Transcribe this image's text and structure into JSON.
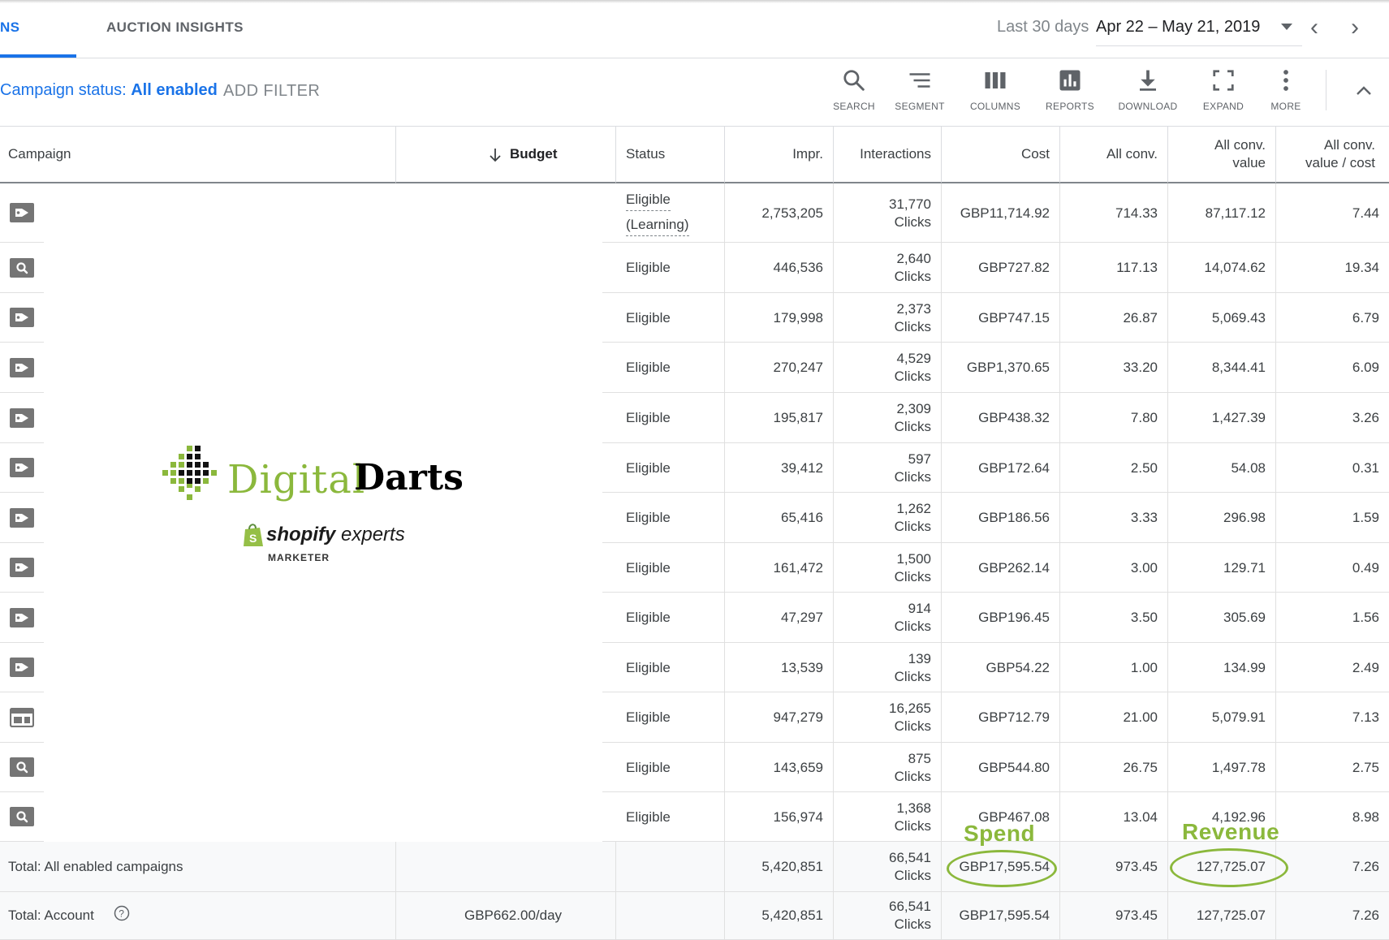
{
  "header": {
    "tab_active": "NS",
    "tab_auction": "AUCTION INSIGHTS",
    "date_label": "Last 30 days",
    "date_range": "Apr 22 – May 21, 2019"
  },
  "filter": {
    "status_label": "Campaign status: ",
    "status_value": "All enabled",
    "add_filter": "ADD FILTER"
  },
  "toolbar": {
    "search": "SEARCH",
    "segment": "SEGMENT",
    "columns": "COLUMNS",
    "reports": "REPORTS",
    "download": "DOWNLOAD",
    "expand": "EXPAND",
    "more": "MORE"
  },
  "columns": {
    "campaign": "Campaign",
    "budget": "Budget",
    "status": "Status",
    "impr": "Impr.",
    "interactions": "Interactions",
    "cost": "Cost",
    "all_conv": "All conv.",
    "all_conv_value_1": "All conv.",
    "all_conv_value_2": "value",
    "value_cost_1": "All conv.",
    "value_cost_2": "value / cost"
  },
  "rows": [
    {
      "icon": "shopping-tag-icon",
      "status": "Eligible",
      "status_sub": "(Learning)",
      "impr": "2,753,205",
      "int_n": "31,770",
      "int_unit": "Clicks",
      "cost": "GBP11,714.92",
      "conv": "714.33",
      "value": "87,117.12",
      "vc": "7.44"
    },
    {
      "icon": "search-campaign-icon",
      "status": "Eligible",
      "status_sub": "",
      "impr": "446,536",
      "int_n": "2,640",
      "int_unit": "Clicks",
      "cost": "GBP727.82",
      "conv": "117.13",
      "value": "14,074.62",
      "vc": "19.34"
    },
    {
      "icon": "shopping-tag-icon",
      "status": "Eligible",
      "status_sub": "",
      "impr": "179,998",
      "int_n": "2,373",
      "int_unit": "Clicks",
      "cost": "GBP747.15",
      "conv": "26.87",
      "value": "5,069.43",
      "vc": "6.79"
    },
    {
      "icon": "shopping-tag-icon",
      "status": "Eligible",
      "status_sub": "",
      "impr": "270,247",
      "int_n": "4,529",
      "int_unit": "Clicks",
      "cost": "GBP1,370.65",
      "conv": "33.20",
      "value": "8,344.41",
      "vc": "6.09"
    },
    {
      "icon": "shopping-tag-icon",
      "status": "Eligible",
      "status_sub": "",
      "impr": "195,817",
      "int_n": "2,309",
      "int_unit": "Clicks",
      "cost": "GBP438.32",
      "conv": "7.80",
      "value": "1,427.39",
      "vc": "3.26"
    },
    {
      "icon": "shopping-tag-icon",
      "status": "Eligible",
      "status_sub": "",
      "impr": "39,412",
      "int_n": "597",
      "int_unit": "Clicks",
      "cost": "GBP172.64",
      "conv": "2.50",
      "value": "54.08",
      "vc": "0.31"
    },
    {
      "icon": "shopping-tag-icon",
      "status": "Eligible",
      "status_sub": "",
      "impr": "65,416",
      "int_n": "1,262",
      "int_unit": "Clicks",
      "cost": "GBP186.56",
      "conv": "3.33",
      "value": "296.98",
      "vc": "1.59"
    },
    {
      "icon": "shopping-tag-icon",
      "status": "Eligible",
      "status_sub": "",
      "impr": "161,472",
      "int_n": "1,500",
      "int_unit": "Clicks",
      "cost": "GBP262.14",
      "conv": "3.00",
      "value": "129.71",
      "vc": "0.49"
    },
    {
      "icon": "shopping-tag-icon",
      "status": "Eligible",
      "status_sub": "",
      "impr": "47,297",
      "int_n": "914",
      "int_unit": "Clicks",
      "cost": "GBP196.45",
      "conv": "3.50",
      "value": "305.69",
      "vc": "1.56"
    },
    {
      "icon": "shopping-tag-icon",
      "status": "Eligible",
      "status_sub": "",
      "impr": "13,539",
      "int_n": "139",
      "int_unit": "Clicks",
      "cost": "GBP54.22",
      "conv": "1.00",
      "value": "134.99",
      "vc": "2.49"
    },
    {
      "icon": "display-campaign-icon",
      "status": "Eligible",
      "status_sub": "",
      "impr": "947,279",
      "int_n": "16,265",
      "int_unit": "Clicks",
      "cost": "GBP712.79",
      "conv": "21.00",
      "value": "5,079.91",
      "vc": "7.13"
    },
    {
      "icon": "search-campaign-icon",
      "status": "Eligible",
      "status_sub": "",
      "impr": "143,659",
      "int_n": "875",
      "int_unit": "Clicks",
      "cost": "GBP544.80",
      "conv": "26.75",
      "value": "1,497.78",
      "vc": "2.75"
    },
    {
      "icon": "search-campaign-icon",
      "status": "Eligible",
      "status_sub": "",
      "impr": "156,974",
      "int_n": "1,368",
      "int_unit": "Clicks",
      "cost": "GBP467.08",
      "conv": "13.04",
      "value": "4,192.96",
      "vc": "8.98"
    }
  ],
  "totals": [
    {
      "label": "Total: All enabled campaigns",
      "budget": "",
      "impr": "5,420,851",
      "int_n": "66,541",
      "int_unit": "Clicks",
      "cost": "GBP17,595.54",
      "conv": "973.45",
      "value": "127,725.07",
      "vc": "7.26"
    },
    {
      "label": "Total: Account",
      "budget": "GBP662.00/day",
      "impr": "5,420,851",
      "int_n": "66,541",
      "int_unit": "Clicks",
      "cost": "GBP17,595.54",
      "conv": "973.45",
      "value": "127,725.07",
      "vc": "7.26"
    }
  ],
  "overlay": {
    "logo_word1": "Digital",
    "logo_word2": "Darts",
    "shopify_bold": "shopify",
    "shopify_rest": " experts",
    "marketer": "MARKETER",
    "annot_spend": "Spend",
    "annot_revenue": "Revenue"
  },
  "colors": {
    "accent": "#1a73e8",
    "annotation_green": "#8bb83c",
    "icon_gray": "#757575"
  }
}
